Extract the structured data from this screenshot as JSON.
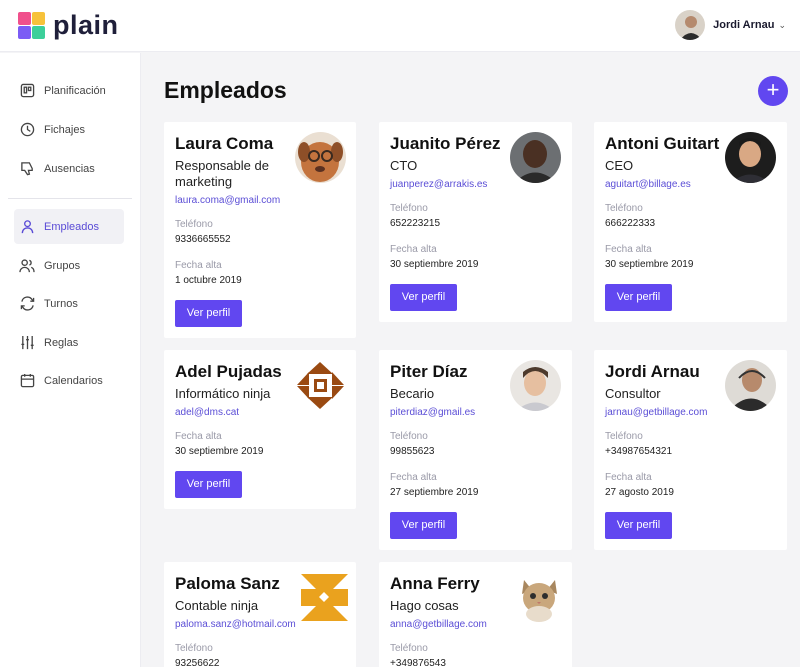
{
  "brand": {
    "name": "plain"
  },
  "user": {
    "name": "Jordi Arnau"
  },
  "sidebar": {
    "items": [
      {
        "label": "Planificación",
        "icon": "board-icon"
      },
      {
        "label": "Fichajes",
        "icon": "clock-icon"
      },
      {
        "label": "Ausencias",
        "icon": "thumbs-down-icon"
      },
      {
        "label": "Empleados",
        "icon": "user-icon",
        "active": true
      },
      {
        "label": "Grupos",
        "icon": "users-icon"
      },
      {
        "label": "Turnos",
        "icon": "refresh-icon"
      },
      {
        "label": "Reglas",
        "icon": "sliders-icon"
      },
      {
        "label": "Calendarios",
        "icon": "calendar-icon"
      }
    ]
  },
  "page": {
    "title": "Empleados",
    "add_label": "+"
  },
  "labels": {
    "phone": "Teléfono",
    "start_date": "Fecha alta",
    "view_profile": "Ver perfil"
  },
  "employees": [
    {
      "name": "Laura Coma",
      "role": "Responsable de marketing",
      "email": "laura.coma@gmail.com",
      "phone": "9336665552",
      "start": "1 octubre 2019",
      "avatar": "dog-photo"
    },
    {
      "name": "Juanito Pérez",
      "role": "CTO",
      "email": "juanperez@arrakis.es",
      "phone": "652223215",
      "start": "30 septiembre 2019",
      "avatar": "person-photo"
    },
    {
      "name": "Antoni Guitart",
      "role": "CEO",
      "email": "aguitart@billage.es",
      "phone": "666222333",
      "start": "30 septiembre 2019",
      "avatar": "person-photo"
    },
    {
      "name": "Adel Pujadas",
      "role": "Informático ninja",
      "email": "adel@dms.cat",
      "phone": "",
      "start": "30 septiembre 2019",
      "avatar": "identicon-brown"
    },
    {
      "name": "Piter Díaz",
      "role": "Becario",
      "email": "piterdiaz@gmail.es",
      "phone": "99855623",
      "start": "27 septiembre 2019",
      "avatar": "person-photo"
    },
    {
      "name": "Jordi Arnau",
      "role": "Consultor",
      "email": "jarnau@getbillage.com",
      "phone": "+34987654321",
      "start": "27 agosto 2019",
      "avatar": "person-photo"
    },
    {
      "name": "Paloma Sanz",
      "role": "Contable ninja",
      "email": "paloma.sanz@hotmail.com",
      "phone": "93256622",
      "start": "",
      "avatar": "identicon-orange"
    },
    {
      "name": "Anna Ferry",
      "role": "Hago cosas",
      "email": "anna@getbillage.com",
      "phone": "+349876543",
      "start": "",
      "avatar": "cat-photo"
    }
  ],
  "colors": {
    "accent": "#6147f0",
    "link": "#5b4ed6"
  }
}
